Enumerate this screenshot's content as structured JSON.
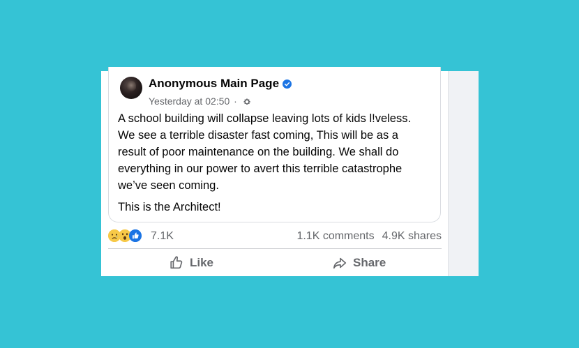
{
  "post": {
    "page_name": "Anonymous Main Page",
    "timestamp": "Yesterday at 02:50",
    "separator": "·",
    "paragraphs": [
      "A school building will collapse leaving lots of kids l!veless. We see a terrible disaster fast coming, This will be as a result of poor maintenance on the building. We shall do everything in our power to avert this terrible catastrophe we’ve seen coming.",
      "This is the Architect!"
    ]
  },
  "engagement": {
    "reaction_icons": [
      "sad-face-icon",
      "wow-face-icon",
      "like-thumb-icon"
    ],
    "reaction_count": "7.1K",
    "comments": "1.1K comments",
    "shares": "4.9K shares"
  },
  "actions": {
    "like_label": "Like",
    "share_label": "Share"
  },
  "colors": {
    "background": "#35c3d5",
    "verified": "#1b74e4",
    "secondary_text": "#65676b"
  }
}
